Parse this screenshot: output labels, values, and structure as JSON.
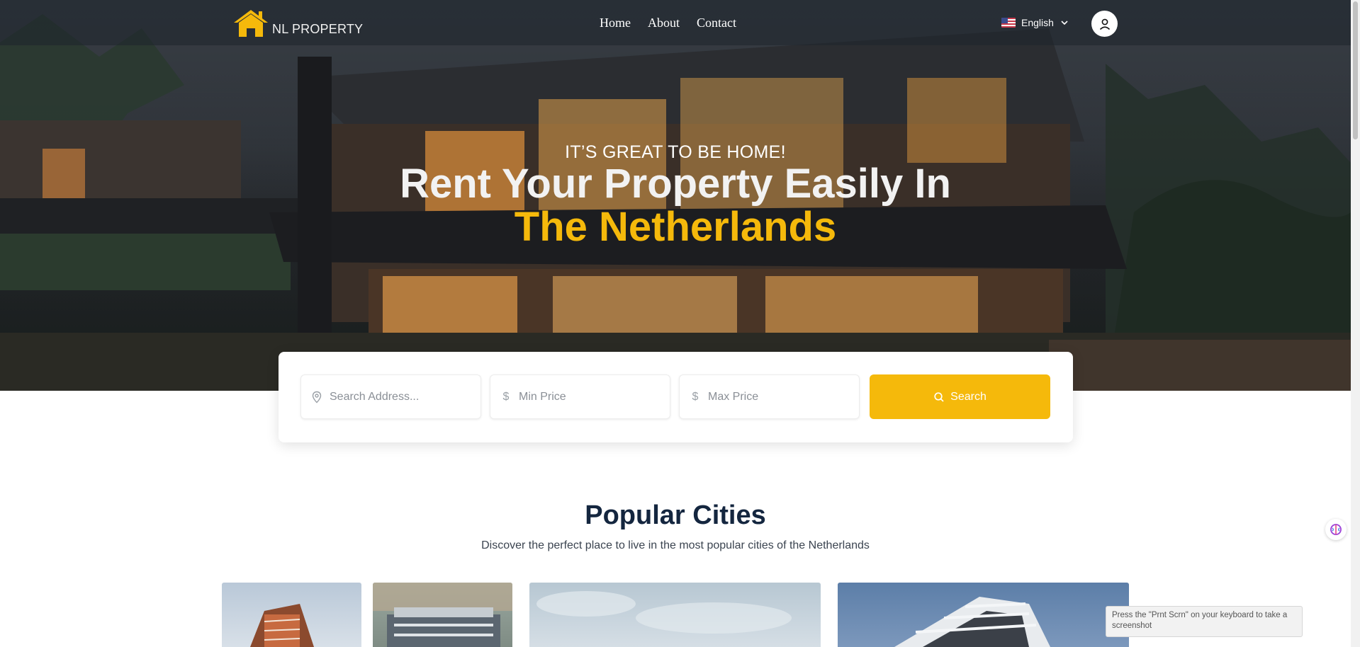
{
  "brand": {
    "name": "NL PROPERTY",
    "accent": "#f5b90b"
  },
  "nav": {
    "links": [
      "Home",
      "About",
      "Contact"
    ]
  },
  "language": {
    "label": "English"
  },
  "hero": {
    "subtitle": "IT’S GREAT TO BE HOME!",
    "title_line1": "Rent Your Property Easily In",
    "title_line2": "The Netherlands"
  },
  "search": {
    "address_placeholder": "Search Address...",
    "min_price_placeholder": "Min Price",
    "max_price_placeholder": "Max Price",
    "button_label": "Search"
  },
  "popular": {
    "title": "Popular Cities",
    "subtitle": "Discover the perfect place to live in the most popular cities of the Netherlands"
  },
  "tooltip": {
    "text": "Press the \"Prnt Scrn\" on your keyboard to take a screenshot"
  }
}
